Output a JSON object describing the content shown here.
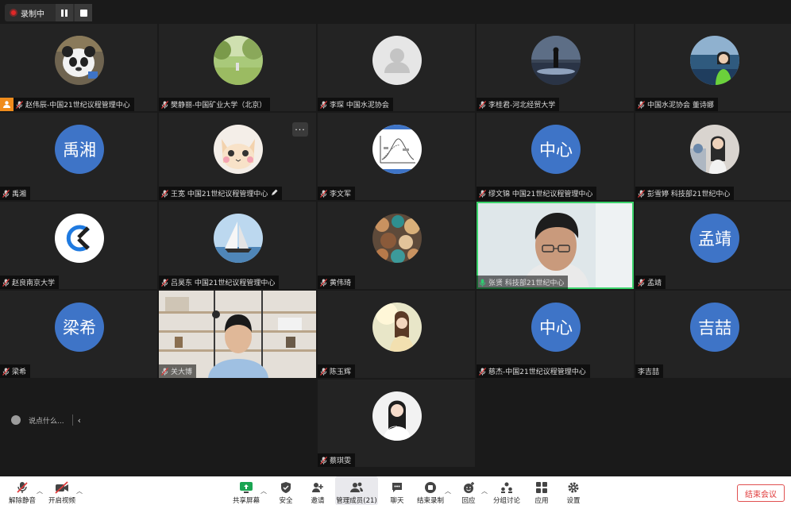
{
  "recording": {
    "label": "录制中"
  },
  "participants": [
    {
      "name": "赵伟辰-中国21世纪议程管理中心",
      "avatar": "panda",
      "host": true
    },
    {
      "name": "樊静丽-中国矿业大学（北京）",
      "avatar": "park"
    },
    {
      "name": "李琛 中国水泥协会",
      "avatar": "default"
    },
    {
      "name": "李桂君-河北经贸大学",
      "avatar": "silhouette"
    },
    {
      "name": "中国水泥协会 董诗娜",
      "avatar": "woman-lake"
    },
    {
      "name": "禹湘",
      "avatar": "text",
      "avatar_text": "禹湘"
    },
    {
      "name": "王宽 中国21世纪议程管理中心",
      "avatar": "cat",
      "editable": true
    },
    {
      "name": "李文军",
      "avatar": "chart"
    },
    {
      "name": "缪文锦 中国21世纪议程管理中心",
      "avatar": "text",
      "avatar_text": "中心"
    },
    {
      "name": "彭雪婷 科技部21世纪中心",
      "avatar": "woman-photo"
    },
    {
      "name": "赵良南京大学",
      "avatar": "logo"
    },
    {
      "name": "吕昊东 中国21世纪议程管理中心",
      "avatar": "sailboat"
    },
    {
      "name": "黄伟琦",
      "avatar": "stones"
    },
    {
      "name": "张贤 科技部21世纪中心",
      "avatar": "video-man",
      "speaking": true
    },
    {
      "name": "孟靖",
      "avatar": "text",
      "avatar_text": "孟靖"
    },
    {
      "name": "梁希",
      "avatar": "text",
      "avatar_text": "梁希"
    },
    {
      "name": "关大博",
      "avatar": "video-office"
    },
    {
      "name": "陈玉辉",
      "avatar": "woman-sun"
    },
    {
      "name": "慈杰-中国21世纪议程管理中心",
      "avatar": "text",
      "avatar_text": "中心"
    },
    {
      "name": "李吉喆",
      "avatar": "text",
      "avatar_text": "吉喆",
      "no_mic": true
    },
    {
      "name": "蔡琪雯",
      "avatar": "woman-white"
    }
  ],
  "chat": {
    "placeholder": "说点什么..."
  },
  "toolbar": {
    "unmute": "解除静音",
    "start_video": "开启视频",
    "share": "共享屏幕",
    "security": "安全",
    "invite": "邀请",
    "participants": "管理成员(21)",
    "chat": "聊天",
    "end_recording": "结束录制",
    "replay": "回应",
    "breakout": "分组讨论",
    "apps": "应用",
    "settings": "设置",
    "end_meeting": "结束会议"
  },
  "colors": {
    "avatar_blue": "#3e74c7",
    "speaking_border": "#3bd36b",
    "host_badge": "#f08c1c",
    "end_red": "#e03b3b"
  }
}
